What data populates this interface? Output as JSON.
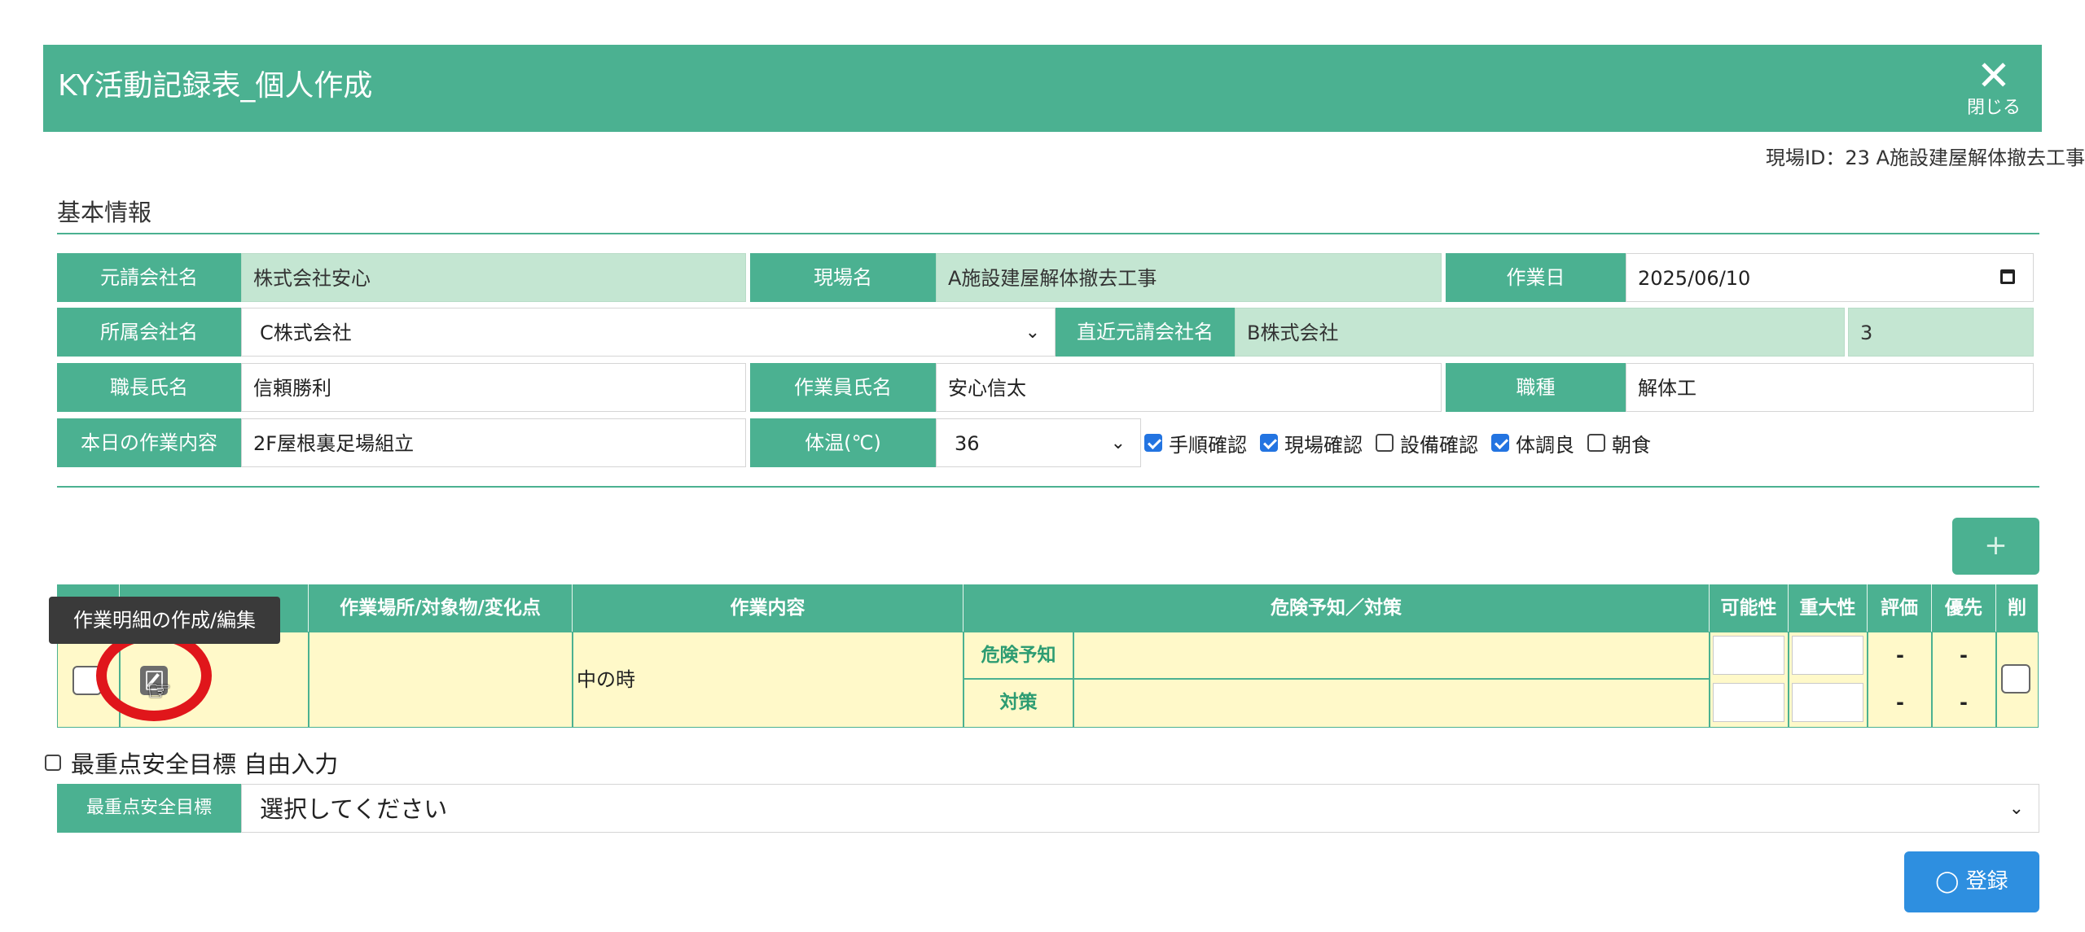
{
  "header": {
    "title": "KY活動記録表_個人作成",
    "close_label": "閉じる",
    "close_glyph": "✕"
  },
  "site_id_text": "現場ID：23 A施設建屋解体撤去工事",
  "basic_info": {
    "section_title": "基本情報",
    "contractor_label": "元請会社名",
    "contractor_value": "株式会社安心",
    "site_label": "現場名",
    "site_value": "A施設建屋解体撤去工事",
    "work_date_label": "作業日",
    "work_date_value": "2025/06/10",
    "company_label": "所属会社名",
    "company_value": "C株式会社",
    "direct_contractor_label": "直近元請会社名",
    "direct_contractor_value": "B株式会社",
    "tier_value": "3",
    "foreman_label": "職長氏名",
    "foreman_value": "信頼勝利",
    "worker_label": "作業員氏名",
    "worker_value": "安心信太",
    "trade_label": "職種",
    "trade_value": "解体工",
    "today_work_label": "本日の作業内容",
    "today_work_value": "2F屋根裏足場組立",
    "temp_label": "体温(℃)",
    "temp_value": "36",
    "checks": [
      {
        "label": "手順確認",
        "checked": true
      },
      {
        "label": "現場確認",
        "checked": true
      },
      {
        "label": "設備確認",
        "checked": false
      },
      {
        "label": "体調良",
        "checked": true
      },
      {
        "label": "朝食",
        "checked": false
      }
    ]
  },
  "add_button": "+",
  "table": {
    "headers": {
      "place": "作業場所/対象物/変化点",
      "content": "作業内容",
      "hazard": "危険予知／対策",
      "likelihood": "可能性",
      "severity": "重大性",
      "evaluation": "評価",
      "priority": "優先",
      "delete": "削"
    },
    "rows": [
      {
        "content": "中の時",
        "hazard_label": "危険予知",
        "measure_label": "対策",
        "evaluation_1": "-",
        "priority_1": "-",
        "evaluation_2": "-",
        "priority_2": "-"
      }
    ]
  },
  "tooltip_text": "作業明細の作成/編集",
  "free_input": {
    "label": "最重点安全目標 自由入力",
    "checked": false
  },
  "safety_goal": {
    "label": "最重点安全目標",
    "value": "選択してください"
  },
  "register_button": "⊘ 登録",
  "register_label": "登録",
  "register_icon": "check-circle-icon",
  "colors": {
    "header_green": "#4bb191",
    "readonly_green": "#c4e6d2",
    "row_yellow": "#fff9c9",
    "register_blue": "#2e8fe0",
    "highlight_red": "#e0161b"
  }
}
